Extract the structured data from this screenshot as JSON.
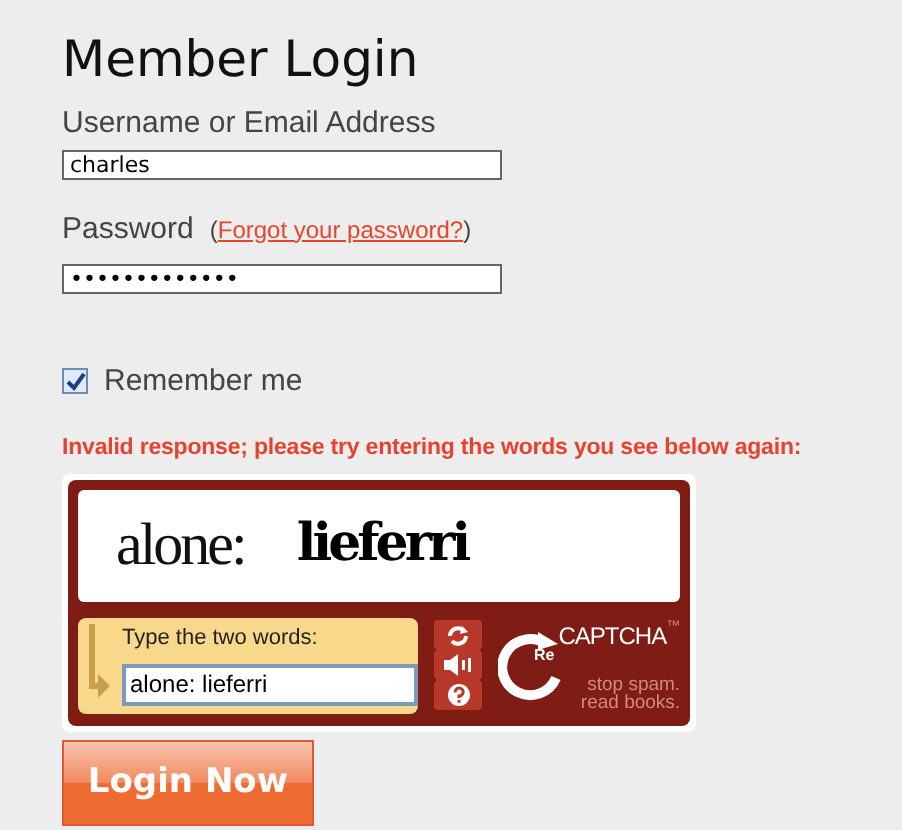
{
  "title": "Member Login",
  "username": {
    "label": "Username or Email Address",
    "value": "charles"
  },
  "password": {
    "label": "Password",
    "link_open": "(",
    "link": "Forgot your password?",
    "link_close": ")",
    "value": "•••••••••••••"
  },
  "remember": {
    "label": "Remember me",
    "checked": true
  },
  "error": "Invalid response; please try entering the words you see below again:",
  "captcha": {
    "words": [
      "alone:",
      "lieferri"
    ],
    "prompt": "Type the two words:",
    "value": "alone: lieferri",
    "logo_re": "Re",
    "logo_name": "CAPTCHA",
    "logo_tm": "™",
    "tagline_1": "stop spam.",
    "tagline_2": "read books."
  },
  "submit": "Login Now"
}
